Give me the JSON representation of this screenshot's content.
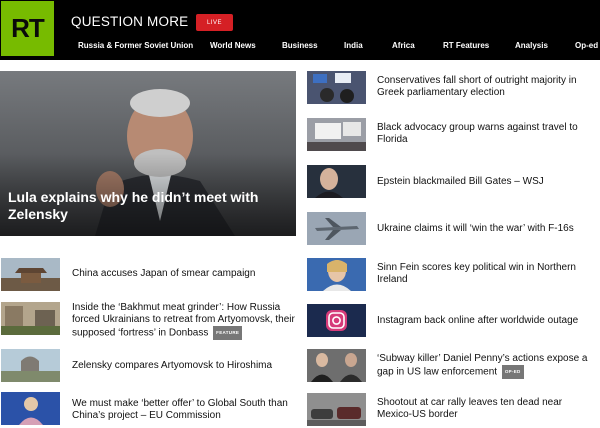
{
  "header": {
    "logo_text": "RT",
    "tagline": "QUESTION MORE",
    "live_label": "LIVE",
    "nav": [
      "Russia & Former Soviet Union",
      "World News",
      "Business",
      "India",
      "Africa",
      "RT Features",
      "Analysis",
      "Op-ed"
    ]
  },
  "hero": {
    "title": "Lula explains why he didn’t meet with Zelensky"
  },
  "left_list": [
    {
      "headline": "China accuses Japan of smear campaign"
    },
    {
      "headline": "Inside the ‘Bakhmut meat grinder’: How Russia forced Ukrainians to retreat from Artyomovsk, their supposed ‘fortress’ in Donbass",
      "badge": "FEATURE"
    },
    {
      "headline": "Zelensky compares Artyomovsk to Hiroshima"
    },
    {
      "headline": "We must make ‘better offer’ to Global South than China’s project – EU Commission"
    }
  ],
  "right_list": [
    {
      "headline": "Conservatives fall short of outright majority in Greek parliamentary election"
    },
    {
      "headline": "Black advocacy group warns against travel to Florida"
    },
    {
      "headline": "Epstein blackmailed Bill Gates – WSJ"
    },
    {
      "headline": "Ukraine claims it will ‘win the war’ with F-16s"
    },
    {
      "headline": "Sinn Fein scores key political win in Northern Ireland"
    },
    {
      "headline": "Instagram back online after worldwide outage"
    },
    {
      "headline": "‘Subway killer’ Daniel Penny’s actions expose a gap in US law enforcement",
      "badge": "OP-ED"
    },
    {
      "headline": "Shootout at car rally leaves ten dead near Mexico-US border"
    }
  ],
  "colors": {
    "header_bg": "#000000",
    "logo_green": "#77bb00",
    "live_red": "#d52025",
    "badge_gray": "#777777"
  }
}
